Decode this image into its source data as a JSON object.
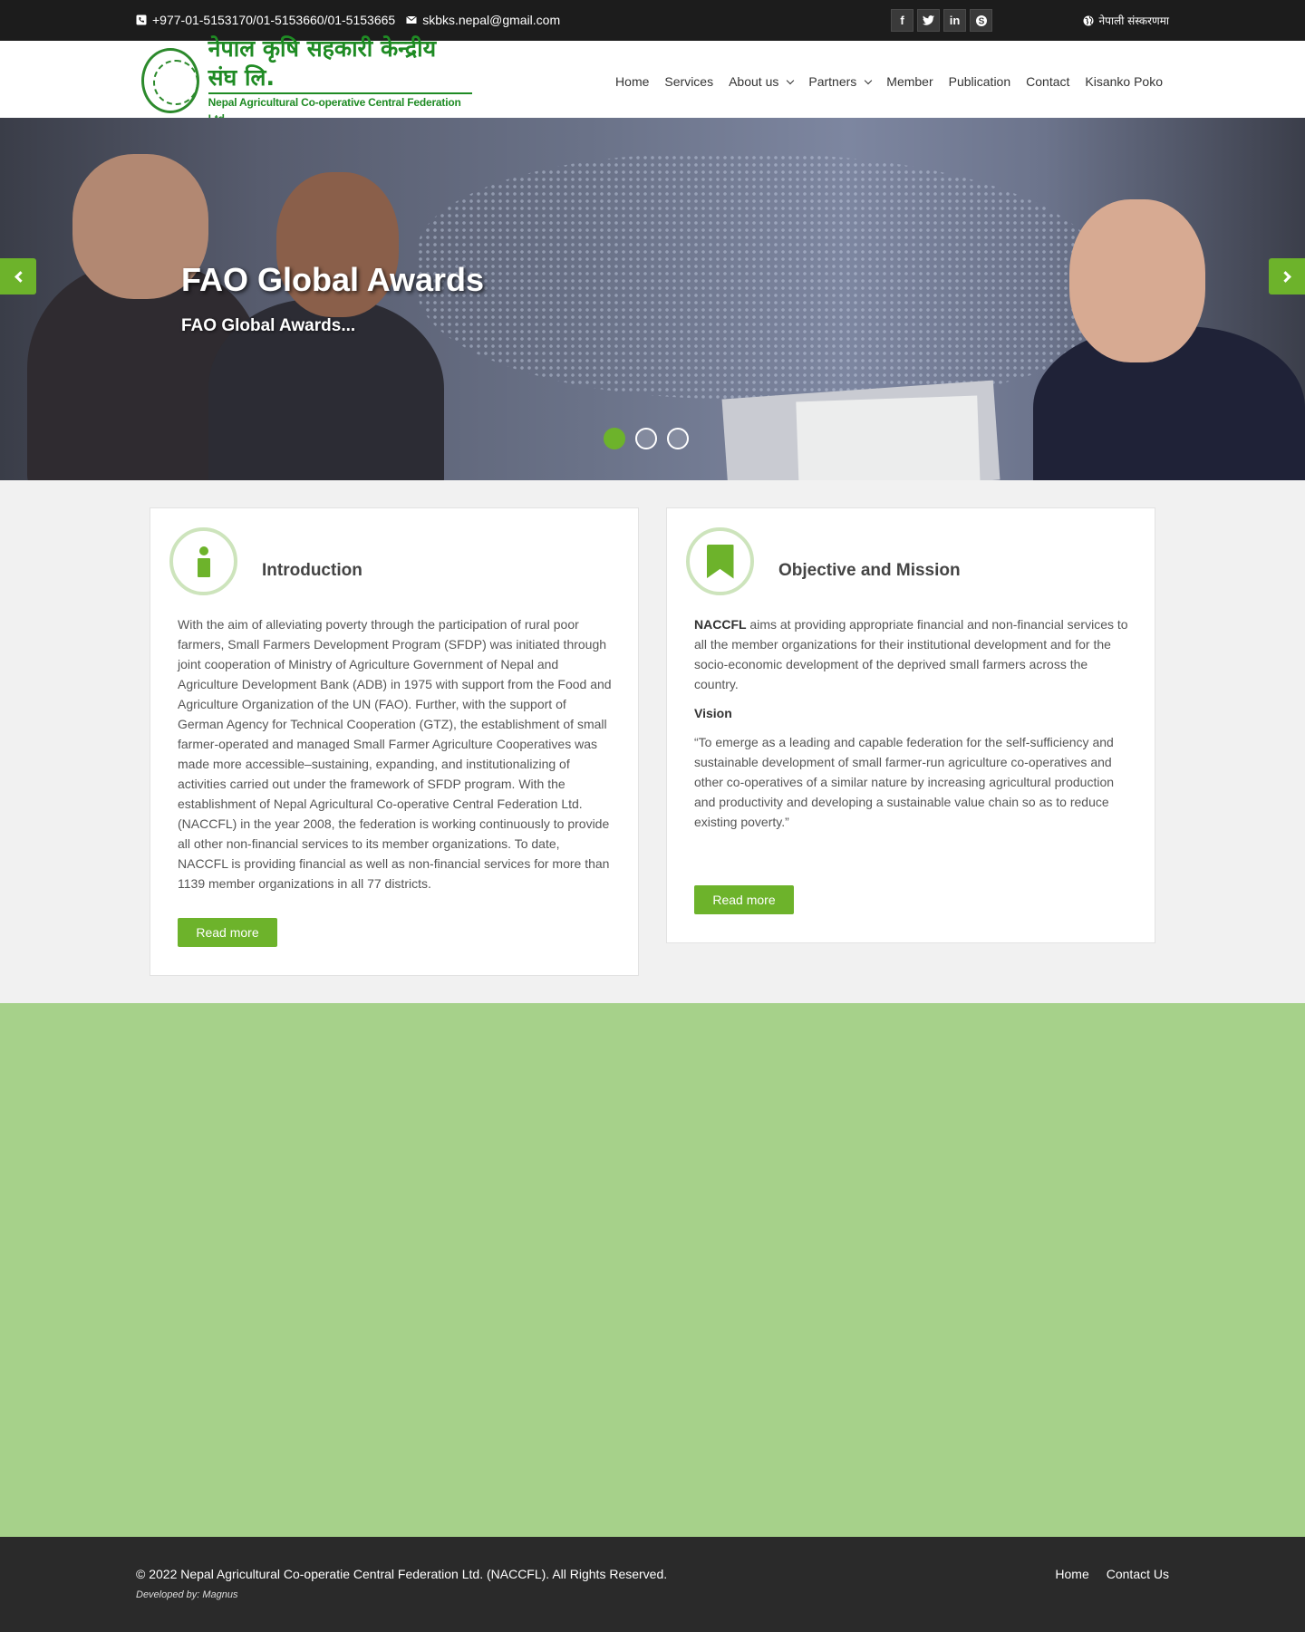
{
  "topbar": {
    "phone": "+977-01-5153170/01-5153660/01-5153665",
    "email": "skbks.nepal@gmail.com",
    "socials": [
      {
        "name": "facebook",
        "glyph": "f"
      },
      {
        "name": "twitter",
        "glyph": "t"
      },
      {
        "name": "linkedin",
        "glyph": "in"
      },
      {
        "name": "skype",
        "glyph": "S"
      }
    ],
    "language": "नेपाली संस्करणमा"
  },
  "header": {
    "logo_nepali": "नेपाल कृषि सहकारी केन्द्रीय संघ लि.",
    "logo_english": "Nepal Agricultural Co-operative Central Federation Ltd.",
    "nav": [
      "Home",
      "Services",
      "About us",
      "Partners",
      "Member",
      "Publication",
      "Contact",
      "Kisanko Poko"
    ]
  },
  "slider": {
    "title": "FAO Global Awards",
    "subtitle": "FAO Global Awards...",
    "slides": 3,
    "active_slide": 1
  },
  "intro": {
    "title": "Introduction",
    "body": "With the aim of alleviating poverty through the participation of rural poor farmers, Small Farmers Development Program (SFDP) was initiated through joint cooperation of Ministry of Agriculture Government of Nepal and Agriculture Development Bank (ADB) in 1975 with support from the Food and Agriculture Organization of the UN (FAO). Further, with the support of German Agency for Technical Cooperation (GTZ), the establishment of small farmer-operated and managed Small Farmer Agriculture Cooperatives was made more accessible–sustaining, expanding, and institutionalizing of activities carried out under the framework of SFDP program. With the establishment of Nepal Agricultural Co-operative Central Federation Ltd. (NACCFL) in the year 2008, the federation is working continuously to provide all other non-financial services to its member organizations. To date, NACCFL is providing financial as well as non-financial services for more than 1139 member organizations in all 77 districts.",
    "button": "Read more"
  },
  "mission": {
    "title": "Objective and Mission",
    "lead_bold": "NACCFL",
    "lead_text": " aims at providing appropriate financial and non-financial services to all the member organizations for their institutional development and for the socio-economic development of the deprived small farmers across the country.",
    "vision_heading": "Vision",
    "vision_text": "“To emerge as a leading and capable federation for the self-sufficiency and sustainable development of small farmer-run agriculture co-operatives and other co-operatives of a similar nature by increasing agricultural production and productivity and developing a sustainable value chain so as to reduce existing poverty.”",
    "button": "Read more"
  },
  "footer": {
    "copyright": "© 2022 Nepal Agricultural Co-operatie Central Federation Ltd. (NACCFL). All Rights Reserved.",
    "developed_by": "Developed by: Magnus",
    "links": [
      "Home",
      "Contact Us"
    ]
  },
  "colors": {
    "accent": "#6db32b",
    "band": "#a6d18a",
    "topbar": "#1c1c1c",
    "footer": "#2a2a2a"
  }
}
